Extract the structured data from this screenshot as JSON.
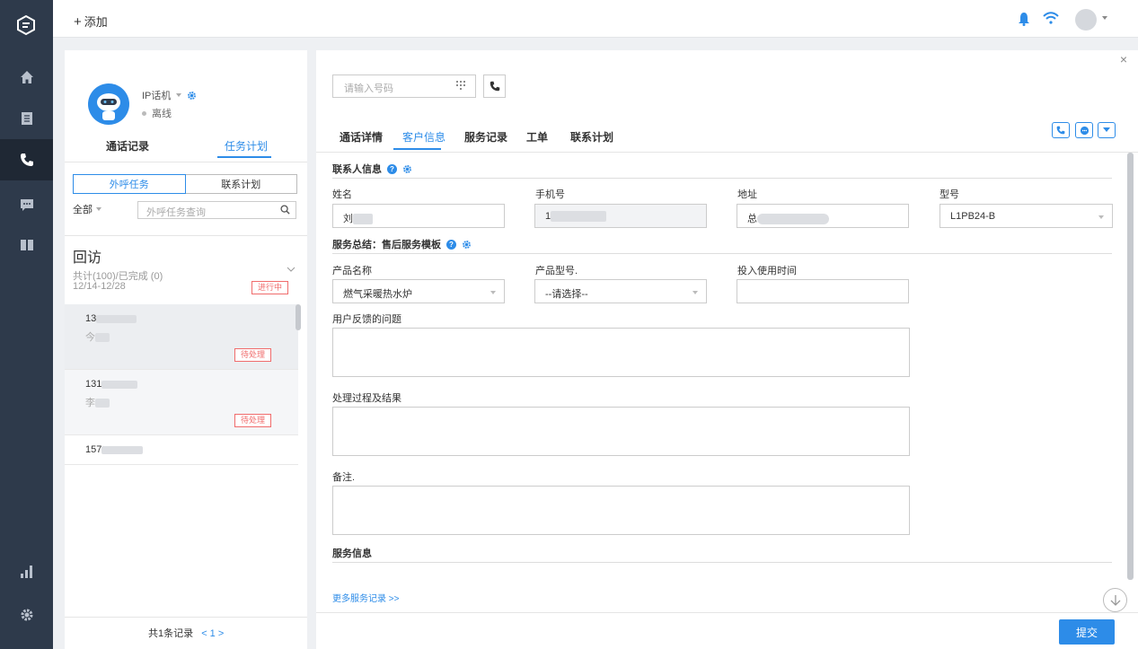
{
  "topbar": {
    "add_label": "添加"
  },
  "left": {
    "ip_label": "IP话机",
    "status": "离线",
    "tabs": [
      "通话记录",
      "任务计划"
    ],
    "segments": [
      "外呼任务",
      "联系计划"
    ],
    "filter_label": "全部",
    "search_placeholder": "外呼任务查询",
    "group": {
      "title": "回访",
      "count": "共计(100)/已完成 (0)",
      "date": "12/14-12/28",
      "badge": "进行中"
    },
    "items": [
      {
        "number": "13",
        "name": "今",
        "badge": "待处理"
      },
      {
        "number": "131",
        "name": "李",
        "badge": "待处理"
      },
      {
        "number": "157"
      }
    ],
    "pager": {
      "text": "共1条记录",
      "current": "< 1 >"
    }
  },
  "right": {
    "phone_placeholder": "请输入号码",
    "tabs": [
      "通话详情",
      "客户信息",
      "服务记录",
      "工单",
      "联系计划"
    ],
    "contact_section": "联系人信息",
    "fields": {
      "name_label": "姓名",
      "name_value": "刘",
      "mobile_label": "手机号",
      "mobile_value": "1",
      "address_label": "地址",
      "address_value": "总",
      "model_label": "型号",
      "model_value": "L1PB24-B"
    },
    "service_section": "服务总结：售后服务模板",
    "service_fields": {
      "product_name_label": "产品名称",
      "product_name_value": "燃气采暖热水炉",
      "product_model_label": "产品型号.",
      "product_model_value": "--请选择--",
      "use_time_label": "投入使用时间",
      "feedback_label": "用户反馈的问题",
      "process_label": "处理过程及结果",
      "note_label": "备注."
    },
    "service_info_section": "服务信息",
    "more_link": "更多服务记录 >>",
    "submit_label": "提交"
  },
  "colors": {
    "accent": "#2d8ce8",
    "nav_bg": "#2e3a4b",
    "badge_red": "#f06c6c"
  }
}
